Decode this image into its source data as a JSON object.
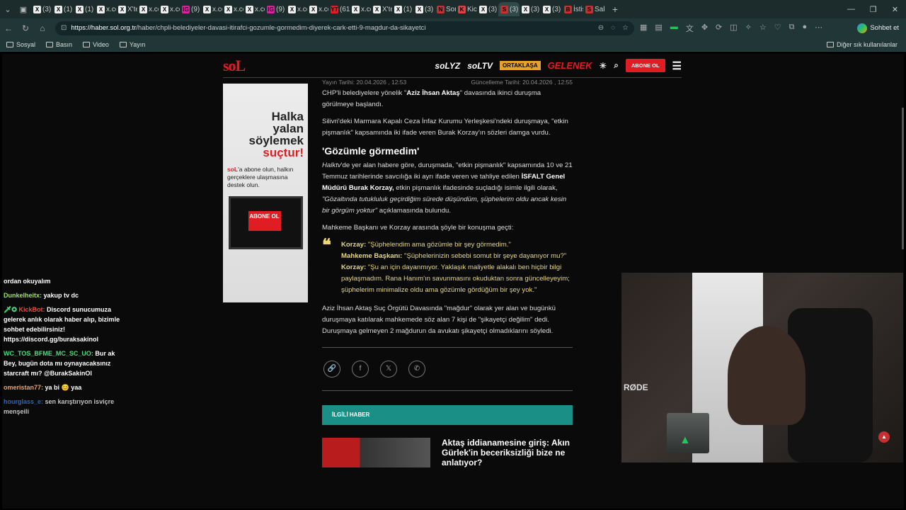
{
  "browser": {
    "tabs": [
      {
        "label": "(3) B",
        "icon": "X"
      },
      {
        "label": "(1) S",
        "icon": "X"
      },
      {
        "label": "(1) X",
        "icon": "X"
      },
      {
        "label": "x.com",
        "icon": "X"
      },
      {
        "label": "X'te",
        "icon": "X"
      },
      {
        "label": "x.com",
        "icon": "X"
      },
      {
        "label": "x.com",
        "icon": "X"
      },
      {
        "label": "(9) In",
        "icon": "IG"
      },
      {
        "label": "x.com",
        "icon": "X"
      },
      {
        "label": "x.com",
        "icon": "X"
      },
      {
        "label": "x.com",
        "icon": "X"
      },
      {
        "label": "(9) In",
        "icon": "IG"
      },
      {
        "label": "x.com",
        "icon": "X"
      },
      {
        "label": "x.com",
        "icon": "X"
      },
      {
        "label": "(616",
        "icon": "YT"
      },
      {
        "label": "x.com",
        "icon": "X"
      },
      {
        "label": "X'te",
        "icon": "X"
      },
      {
        "label": "(1) X",
        "icon": "X"
      },
      {
        "label": "(3) X",
        "icon": "X"
      },
      {
        "label": "Son",
        "icon": "N"
      },
      {
        "label": "Kick",
        "icon": "K"
      },
      {
        "label": "(3) X",
        "icon": "X"
      },
      {
        "label": "(3)",
        "icon": "S"
      },
      {
        "label": "(3) X",
        "icon": "X"
      },
      {
        "label": "(3) X",
        "icon": "X"
      },
      {
        "label": "İstis",
        "icon": "B"
      },
      {
        "label": "Saldı",
        "icon": "S"
      }
    ],
    "url_host": "https://haber.sol.org.tr",
    "url_path": "/haber/chpli-belediyeler-davasi-itirafci-gozumle-gormedim-diyerek-cark-etti-9-magdur-da-sikayetci",
    "copilot_label": "Sohbet et",
    "bookmarks": [
      "Sosyal",
      "Basın",
      "Video",
      "Yayın"
    ],
    "bookmarks_other": "Diğer sık kullanılanlar"
  },
  "site": {
    "logo": "soL",
    "nav": {
      "solyz": "soLYZ",
      "soltv": "soLTV",
      "ortaklasa": "ORTAKLAŞA",
      "gelenek": "GELENEK",
      "subscribe": "ABONE OL"
    },
    "ad": {
      "slogan1": "Halka",
      "slogan2": "yalan",
      "slogan3": "söylemek",
      "slogan4": "suçtur!",
      "brand": "soL",
      "pitch": "'a abone olun, halkın gerçeklere ulaşmasına destek olun.",
      "button": "ABONE OL"
    }
  },
  "article": {
    "published": "Yayın Tarihi: 20.04.2026 , 12:53",
    "updated": "Güncelleme Tarihi: 20.04.2026 , 12:55",
    "p1_a": "CHP'li belediyelere yönelik \"",
    "p1_b": "Aziz İhsan Aktaş",
    "p1_c": "\" davasında ikinci duruşma görülmeye başlandı.",
    "p2": "Silivri'deki Marmara Kapalı Ceza İnfaz Kurumu Yerleşkesi'ndeki duruşmaya, \"etkin pişmanlık\" kapsamında iki ifade veren Burak Korzay'ın sözleri damga vurdu.",
    "heading": "'Gözümle görmedim'",
    "p3_a": "Halktv",
    "p3_b": "'de yer alan habere göre, duruşmada, \"etkin pişmanlık\" kapsamında 10 ve 21 Temmuz tarihlerinde savcılığa iki ayrı ifade veren ve tahliye edilen ",
    "p3_c": "İSFALT Genel Müdürü Burak Korzay,",
    "p3_d": " etkin pişmanlık ifadesinde suçladığı isimle ilgili olarak, ",
    "p3_e": "\"Gözaltında tutukluluk geçirdiğim sürede düşündüm, şüphelerim oldu ancak kesin bir görgüm yoktur\"",
    "p3_f": " açıklamasında bulundu.",
    "p4": "Mahkeme Başkanı ve Korzay arasında şöyle bir konuşma geçti:",
    "q1_name": "Korzay:",
    "q1_text": " \"Şüphelendim ama gözümle bir şey görmedim.\"",
    "q2_name": "Mahkeme Başkanı:",
    "q2_text": " \"Şüphelerinizin sebebi somut bir şeye dayanıyor mu?\"",
    "q3_name": "Korzay:",
    "q3_text": " \"Şu an için dayanmıyor. Yaklaşık maliyetle alakalı ben hiçbir bilgi paylaşmadım. Rana Hanım'ın savunmasını okuduktan sonra güncelleyeyim; şüphelerim minimalize oldu ama gözümle gördüğüm bir şey yok.\"",
    "p5": "Aziz İhsan Aktaş Suç Örgütü Davasında \"mağdur\" olarak yer alan ve bugünkü duruşmaya katılarak mahkemede söz alan 7 kişi de \"şikayetçi değilim\" dedi. Duruşmaya gelmeyen 2 mağdurun da avukatı şikayetçi olmadıklarını söyledi.",
    "related_header": "İLGİLİ HABER",
    "related_title": "Aktaş iddianamesine giriş: Akın Gürlek'in beceriksizliği bize ne anlatıyor?"
  },
  "chat": {
    "m0_text": "ordan okuyalım",
    "m1_user": "Dunkelheitx:",
    "m1_text": " yakup tv dc",
    "m2_user": "KickBot:",
    "m2_text": " Discord sunucumuza gelerek anlık olarak haber alıp, bizimle sohbet edebilirsiniz! https://discord.gg/buraksakinol",
    "m3_user": "WC_TOS_BFME_MC_SC_UO:",
    "m3_text": " Bur ak Bey, bugün dota mı oynayacaksınız starcraft mı? @BurakSakinOl",
    "m4_user": "omeristan77:",
    "m4_text": " ya bi 😊 yaa",
    "m5_user": "hourglass_e:",
    "m5_text": " sen karıştırıyon isviçre menşeili"
  },
  "webcam": {
    "mic_brand": "RØDE"
  },
  "colors": {
    "brand_red": "#e11d24",
    "quote_yellow": "#e9d77a",
    "related_teal": "#1a8f86"
  }
}
